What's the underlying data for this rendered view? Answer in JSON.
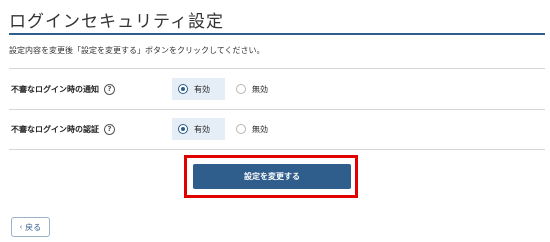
{
  "page": {
    "title": "ログインセキュリティ設定",
    "instruction": "設定内容を変更後「設定を変更する」ボタンをクリックしてください。"
  },
  "settings": [
    {
      "label": "不審なログイン時の通知",
      "help_icon": "?",
      "selected": "有効",
      "options": [
        "有効",
        "無効"
      ]
    },
    {
      "label": "不審なログイン時の認証",
      "help_icon": "?",
      "selected": "有効",
      "options": [
        "有効",
        "無効"
      ]
    }
  ],
  "actions": {
    "submit_label": "設定を変更する",
    "back_label": "戻る",
    "back_icon": "‹"
  },
  "colors": {
    "accent": "#2f5d8c",
    "highlight_frame": "#e00000",
    "selected_bg": "#e5eef7"
  }
}
